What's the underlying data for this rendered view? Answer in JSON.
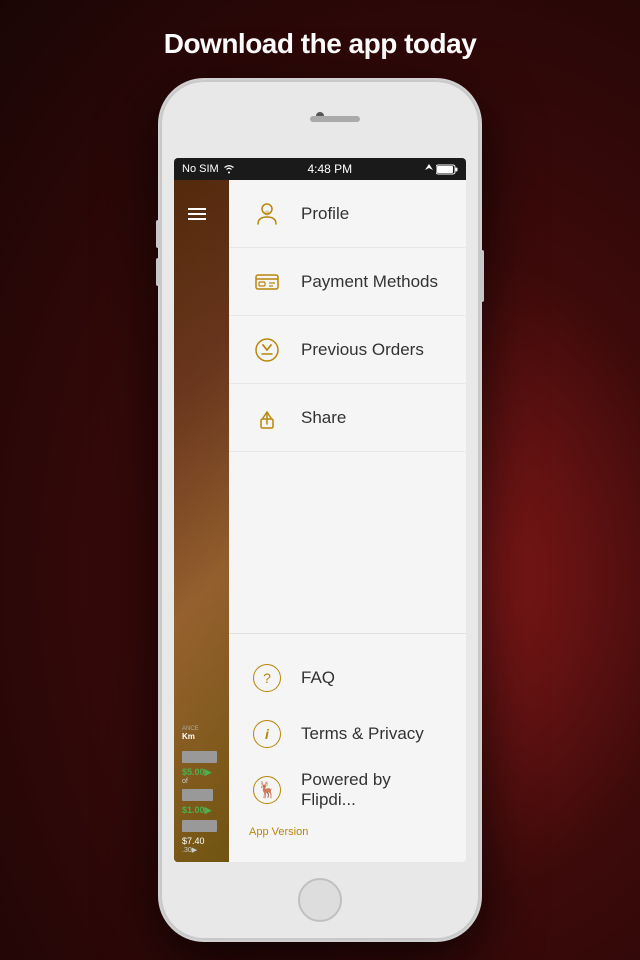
{
  "page": {
    "title": "Download the app today"
  },
  "status_bar": {
    "carrier": "No SIM",
    "time": "4:48 PM",
    "signal_icon": "📶",
    "location_icon": "▷",
    "battery_icon": "🔋"
  },
  "menu": {
    "items_top": [
      {
        "id": "profile",
        "label": "Profile",
        "icon_type": "person"
      },
      {
        "id": "payment",
        "label": "Payment Methods",
        "icon_type": "wallet"
      },
      {
        "id": "orders",
        "label": "Previous Orders",
        "icon_type": "fork-knife"
      },
      {
        "id": "share",
        "label": "Share",
        "icon_type": "share"
      }
    ],
    "items_bottom": [
      {
        "id": "faq",
        "label": "FAQ",
        "icon_type": "question"
      },
      {
        "id": "terms",
        "label": "Terms & Privacy",
        "icon_type": "info"
      },
      {
        "id": "powered",
        "label": "Powered  by Flipdi...",
        "icon_type": "flipdi"
      }
    ],
    "app_version_label": "App Version"
  },
  "sidebar": {
    "distance_label": "Km",
    "distance_prefix": "ANCE",
    "prices": [
      "$5.00",
      "$1.00",
      "$7.40"
    ]
  }
}
